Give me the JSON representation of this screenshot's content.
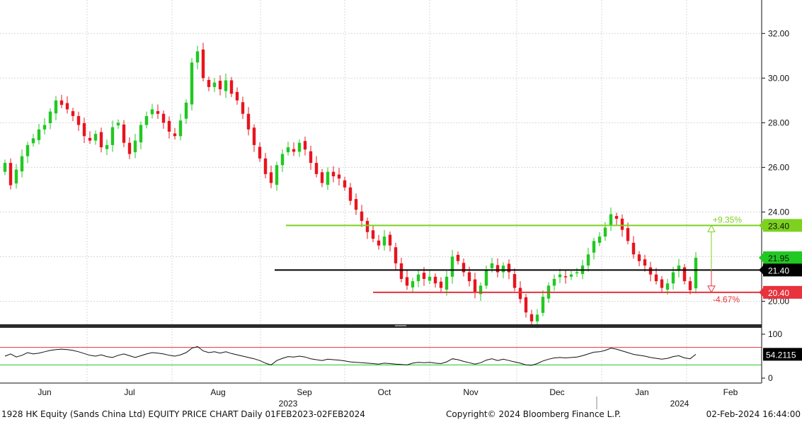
{
  "footer": {
    "left": "1928 HK Equity (Sands China Ltd) EQUITY PRICE CHART  Daily 01FEB2023-02FEB2024",
    "copyright": "Copyright© 2024 Bloomberg Finance L.P.",
    "timestamp": "02-Feb-2024 16:44:00"
  },
  "colors": {
    "up": "#22c822",
    "down": "#e8141e",
    "resistance": "#7cd21e",
    "pivot": "#000000",
    "support": "#e8323c"
  },
  "chart_data": [
    {
      "type": "candlestick",
      "title": "",
      "x_ticks": [
        "Jun",
        "Jul",
        "Aug",
        "Sep",
        "Oct",
        "Nov",
        "Dec",
        "Jan",
        "Feb"
      ],
      "year_labels": [
        "2023",
        "2024"
      ],
      "y_ticks": [
        "20.00",
        "22.00",
        "24.00",
        "26.00",
        "28.00",
        "30.00",
        "32.00"
      ],
      "ylim": [
        19.0,
        33.5
      ],
      "grid": true,
      "close_series": [
        26.2,
        25.2,
        25.9,
        26.5,
        27.0,
        27.3,
        27.7,
        27.9,
        28.5,
        29.0,
        28.8,
        28.6,
        28.3,
        27.9,
        27.4,
        27.2,
        27.5,
        26.9,
        27.0,
        27.8,
        28.0,
        27.1,
        26.6,
        27.2,
        27.9,
        28.3,
        28.6,
        28.4,
        28.0,
        27.6,
        27.4,
        28.1,
        28.9,
        30.7,
        31.2,
        30.0,
        29.6,
        29.8,
        29.5,
        29.9,
        29.3,
        29.0,
        28.4,
        27.7,
        27.0,
        26.4,
        25.7,
        25.3,
        26.1,
        26.6,
        26.9,
        26.7,
        27.1,
        26.8,
        26.2,
        25.7,
        25.3,
        25.8,
        25.6,
        25.5,
        25.1,
        24.5,
        24.1,
        23.6,
        23.1,
        22.8,
        22.5,
        22.9,
        22.5,
        21.7,
        21.0,
        20.7,
        20.9,
        21.2,
        21.0,
        21.1,
        20.8,
        20.6,
        21.1,
        22.0,
        21.8,
        21.3,
        20.9,
        20.4,
        20.7,
        21.4,
        21.7,
        21.3,
        21.6,
        21.3,
        20.6,
        20.1,
        19.5,
        19.1,
        19.4,
        20.2,
        20.7,
        21.0,
        21.2,
        21.1,
        21.2,
        21.3,
        21.6,
        22.1,
        22.7,
        22.9,
        23.3,
        23.9,
        23.7,
        23.2,
        22.7,
        22.1,
        21.8,
        21.6,
        21.2,
        20.9,
        20.6,
        20.8,
        21.3,
        21.6,
        20.9,
        20.5,
        21.95
      ]
    },
    {
      "type": "line",
      "title": "",
      "y_ticks": [
        "0",
        "100"
      ],
      "ylim": [
        0,
        100
      ],
      "bands": [
        70,
        30
      ],
      "last_value": "54.2115",
      "values": [
        50,
        55,
        48,
        52,
        58,
        55,
        57,
        60,
        63,
        65,
        66,
        65,
        63,
        60,
        56,
        52,
        50,
        53,
        49,
        47,
        52,
        55,
        51,
        47,
        51,
        55,
        58,
        57,
        55,
        52,
        50,
        53,
        58,
        68,
        72,
        62,
        58,
        60,
        57,
        60,
        56,
        53,
        50,
        47,
        44,
        40,
        34,
        30,
        40,
        45,
        49,
        48,
        50,
        48,
        44,
        42,
        40,
        43,
        42,
        41,
        39,
        37,
        36,
        35,
        34,
        33,
        32,
        34,
        33,
        32,
        31,
        30,
        34,
        36,
        35,
        36,
        34,
        33,
        37,
        44,
        42,
        38,
        35,
        32,
        35,
        41,
        44,
        40,
        43,
        40,
        37,
        34,
        30,
        29,
        33,
        39,
        43,
        46,
        47,
        46,
        47,
        48,
        51,
        55,
        59,
        60,
        63,
        68,
        66,
        62,
        58,
        54,
        52,
        50,
        47,
        45,
        43,
        45,
        49,
        51,
        46,
        44,
        54.2115
      ]
    }
  ],
  "markers": {
    "resistance": {
      "value": "23.40",
      "pct": "+9.35%"
    },
    "current": {
      "value": "21.95"
    },
    "pivot": {
      "value": "21.40"
    },
    "support": {
      "value": "20.40",
      "pct": "-4.67%"
    }
  }
}
